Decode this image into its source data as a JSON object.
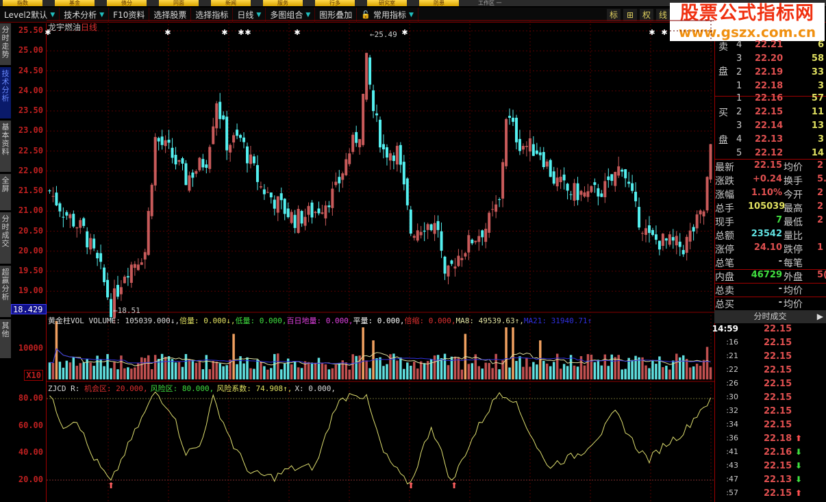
{
  "menu": [
    "指数",
    "基金",
    "债分",
    "同面",
    "新闻",
    "服务",
    "行多",
    "研究室",
    "防患"
  ],
  "menu_title": "工作区 一",
  "toolbar": [
    "Level2默认",
    "技术分析",
    "F10资料",
    "选择股票",
    "选择指标",
    "日线",
    "多图组合",
    "图形叠加",
    "常用指标"
  ],
  "toolbar_right": [
    "标",
    "⊞",
    "权",
    "线"
  ],
  "watermark": {
    "line1": "股票公式指标网",
    "line2": "www.gszx.com.cn"
  },
  "side_tabs": [
    "分时走势",
    "技术分析",
    "基本资料",
    "全屏",
    "分时成交",
    "超赢分析",
    "其他"
  ],
  "stock": {
    "name": "龙宇燃油",
    "period": "日线"
  },
  "price_ticks": [
    "25.50",
    "25.00",
    "24.50",
    "24.00",
    "23.50",
    "23.00",
    "22.50",
    "22.00",
    "21.50",
    "21.00",
    "20.50",
    "20.00",
    "19.50",
    "19.00"
  ],
  "cursor_price": "18.429",
  "annotations": {
    "high": "25.49",
    "low": "18.51"
  },
  "volume_panel": {
    "title": "黄金柱VOL",
    "items": [
      {
        "text": "VOLUME: 105039.000↓,",
        "color": "#dddddd"
      },
      {
        "text": "倍量: 0.000↓,",
        "color": "#e0e060"
      },
      {
        "text": "低量: 0.000,",
        "color": "#40e040"
      },
      {
        "text": "百日地量: 0.000,",
        "color": "#e040e0"
      },
      {
        "text": "平量: 0.000,",
        "color": "#ffffff"
      },
      {
        "text": "倍缩: 0.000,",
        "color": "#e03030"
      },
      {
        "text": "MA8: 49539.63↑,",
        "color": "#e0e0a0"
      },
      {
        "text": "MA21: 31940.71↑",
        "color": "#3030e0"
      }
    ],
    "tick": "10000",
    "unit": "X10"
  },
  "osc_panel": {
    "title": "ZJCD R:",
    "items": [
      {
        "text": "机会区: 20.000,",
        "color": "#e03030"
      },
      {
        "text": "风险区: 80.000,",
        "color": "#40e040"
      },
      {
        "text": "风险系数: 74.908↑,",
        "color": "#e0e060"
      },
      {
        "text": "X: 0.000,",
        "color": "#dddddd"
      }
    ],
    "ticks": [
      "80.00",
      "60.00",
      "40.00",
      "20.00"
    ]
  },
  "order_book": {
    "sell_label": [
      "卖",
      "盘"
    ],
    "buy_label": [
      "买",
      "盘"
    ],
    "sell": [
      {
        "n": "4",
        "p": "22.21",
        "v": "6"
      },
      {
        "n": "3",
        "p": "22.20",
        "v": "58"
      },
      {
        "n": "2",
        "p": "22.19",
        "v": "33"
      },
      {
        "n": "1",
        "p": "22.18",
        "v": "3"
      }
    ],
    "buy": [
      {
        "n": "1",
        "p": "22.16",
        "v": "57"
      },
      {
        "n": "2",
        "p": "22.15",
        "v": "11"
      },
      {
        "n": "3",
        "p": "22.14",
        "v": "13"
      },
      {
        "n": "4",
        "p": "22.13",
        "v": "3"
      },
      {
        "n": "5",
        "p": "22.12",
        "v": "14"
      }
    ]
  },
  "quote": [
    {
      "k": "最新",
      "v": "22.15",
      "c": "#e05050",
      "k2": "均价",
      "v2": "2"
    },
    {
      "k": "涨跌",
      "v": "+0.24",
      "c": "#e05050",
      "k2": "换手",
      "v2": "5."
    },
    {
      "k": "涨幅",
      "v": "1.10%",
      "c": "#e05050",
      "k2": "今开",
      "v2": "2"
    },
    {
      "k": "总手",
      "v": "105039",
      "c": "#e0e060",
      "k2": "最高",
      "v2": "2"
    },
    {
      "k": "现手",
      "v": "7",
      "c": "#40e040",
      "k2": "最低",
      "v2": "2"
    },
    {
      "k": "总额",
      "v": "23542",
      "c": "#60e0e0",
      "k2": "量比",
      "v2": ""
    },
    {
      "k": "涨停",
      "v": "24.10",
      "c": "#e05050",
      "k2": "跌停",
      "v2": "1"
    },
    {
      "k": "总笔",
      "v": "-",
      "c": "#ccc",
      "k2": "每笔",
      "v2": ""
    },
    {
      "k": "内盘",
      "v": "46729",
      "c": "#40e040",
      "k2": "外盘",
      "v2": "5("
    },
    {
      "k": "总卖",
      "v": "-",
      "c": "#ccc",
      "k2": "均价",
      "v2": ""
    },
    {
      "k": "总买",
      "v": "-",
      "c": "#ccc",
      "k2": "均价",
      "v2": ""
    }
  ],
  "ticks_panel": {
    "title": "分时成交",
    "rows": [
      {
        "t": "14:59",
        "p": "22.15",
        "a": ""
      },
      {
        "t": ":16",
        "p": "22.15",
        "a": ""
      },
      {
        "t": ":21",
        "p": "22.15",
        "a": ""
      },
      {
        "t": ":22",
        "p": "22.15",
        "a": ""
      },
      {
        "t": ":26",
        "p": "22.15",
        "a": ""
      },
      {
        "t": ":30",
        "p": "22.15",
        "a": ""
      },
      {
        "t": ":32",
        "p": "22.15",
        "a": ""
      },
      {
        "t": ":34",
        "p": "22.15",
        "a": ""
      },
      {
        "t": ":36",
        "p": "22.18",
        "a": "up"
      },
      {
        "t": ":41",
        "p": "22.16",
        "a": "down"
      },
      {
        "t": ":43",
        "p": "22.15",
        "a": "down"
      },
      {
        "t": ":47",
        "p": "22.13",
        "a": "down"
      },
      {
        "t": ":57",
        "p": "22.15",
        "a": "up"
      }
    ]
  },
  "colors": {
    "up": "#c85a5a",
    "down": "#54f0f0",
    "grid": "#5a0000",
    "axis": "#c02020"
  },
  "chart_data": {
    "type": "candlestick",
    "ylim": [
      18.4,
      25.6
    ],
    "price_path": [
      [
        0,
        21.5
      ],
      [
        4,
        21
      ],
      [
        10,
        20.5
      ],
      [
        15,
        19.5
      ],
      [
        18,
        18.6
      ],
      [
        22,
        19.5
      ],
      [
        28,
        20
      ],
      [
        31,
        22.8
      ],
      [
        35,
        22.5
      ],
      [
        40,
        21.8
      ],
      [
        46,
        22.3
      ],
      [
        49,
        23.8
      ],
      [
        52,
        22.7
      ],
      [
        56,
        22.8
      ],
      [
        62,
        21.6
      ],
      [
        68,
        21.1
      ],
      [
        72,
        20.8
      ],
      [
        78,
        21
      ],
      [
        84,
        21.5
      ],
      [
        88,
        22.5
      ],
      [
        91,
        23
      ],
      [
        93,
        24.7
      ],
      [
        95,
        23.5
      ],
      [
        98,
        22.5
      ],
      [
        102,
        22.5
      ],
      [
        106,
        20.5
      ],
      [
        110,
        20.7
      ],
      [
        114,
        20.6
      ],
      [
        116,
        19.2
      ],
      [
        119,
        19.8
      ],
      [
        124,
        20.3
      ],
      [
        128,
        20.6
      ],
      [
        132,
        21.2
      ],
      [
        134,
        23.4
      ],
      [
        138,
        22.7
      ],
      [
        144,
        22.5
      ],
      [
        148,
        21.8
      ],
      [
        152,
        21.5
      ],
      [
        158,
        21.4
      ],
      [
        164,
        21.6
      ],
      [
        168,
        22.2
      ],
      [
        172,
        21
      ],
      [
        176,
        20.3
      ],
      [
        182,
        20.2
      ],
      [
        186,
        20.1
      ],
      [
        192,
        21
      ],
      [
        194,
        22.5
      ]
    ],
    "osc_path": [
      [
        0,
        82
      ],
      [
        4,
        60
      ],
      [
        8,
        65
      ],
      [
        12,
        40
      ],
      [
        18,
        18
      ],
      [
        22,
        40
      ],
      [
        26,
        60
      ],
      [
        31,
        85
      ],
      [
        36,
        70
      ],
      [
        40,
        40
      ],
      [
        44,
        45
      ],
      [
        48,
        80
      ],
      [
        54,
        45
      ],
      [
        59,
        25
      ],
      [
        66,
        22
      ],
      [
        70,
        28
      ],
      [
        78,
        30
      ],
      [
        84,
        75
      ],
      [
        89,
        85
      ],
      [
        93,
        80
      ],
      [
        98,
        40
      ],
      [
        104,
        20
      ],
      [
        106,
        18
      ],
      [
        112,
        60
      ],
      [
        115,
        40
      ],
      [
        118,
        18
      ],
      [
        122,
        40
      ],
      [
        126,
        60
      ],
      [
        132,
        85
      ],
      [
        136,
        80
      ],
      [
        140,
        60
      ],
      [
        146,
        30
      ],
      [
        156,
        40
      ],
      [
        162,
        55
      ],
      [
        166,
        70
      ],
      [
        172,
        45
      ],
      [
        176,
        35
      ],
      [
        180,
        45
      ],
      [
        186,
        55
      ],
      [
        192,
        75
      ],
      [
        194,
        78
      ]
    ],
    "volume_spikes": [
      [
        2,
        9
      ],
      [
        54,
        7
      ],
      [
        92,
        8
      ],
      [
        95,
        6
      ],
      [
        122,
        7
      ],
      [
        134,
        8
      ],
      [
        136,
        8
      ],
      [
        144,
        6
      ],
      [
        193,
        5
      ]
    ]
  }
}
